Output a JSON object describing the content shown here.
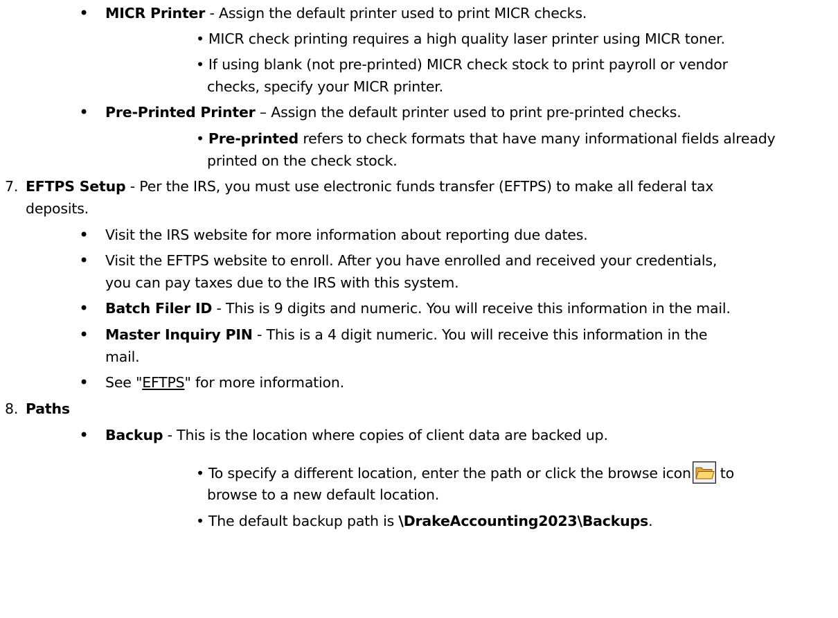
{
  "micr": {
    "term": "MICR Printer",
    "desc": " - Assign the default printer used to print MICR checks.",
    "sub1": "MICR check printing requires a high quality laser printer using MICR toner.",
    "sub2_l1": "If using blank (not pre-printed) MICR check stock to print payroll or vendor",
    "sub2_l2": "checks, specify your MICR printer."
  },
  "preprinted": {
    "term": "Pre-Printed Printer",
    "desc": " – Assign the default printer used to print pre-printed checks.",
    "sub_term": "Pre-printed",
    "sub_l1": " refers to check formats that have many informational fields already",
    "sub_l2": "printed on the check stock."
  },
  "eftps": {
    "num": "7.",
    "term": "EFTPS Setup",
    "desc_l1": " - Per the IRS, you must use electronic funds transfer (EFTPS) to make all federal tax",
    "desc_l2": "deposits.",
    "b1": "Visit the IRS website for more information about reporting due dates.",
    "b2_l1": "Visit the EFTPS website to enroll. After you have enrolled and received your credentials,",
    "b2_l2": "you can pay taxes due to the IRS with this system.",
    "b3_term": "Batch Filer ID",
    "b3_desc": " - This is 9 digits and numeric. You will receive this information in the mail.",
    "b4_term": "Master Inquiry PIN",
    "b4_desc_l1": " - This is a 4 digit numeric. You will receive this information in the",
    "b4_desc_l2": "mail.",
    "b5_pre": "See \"",
    "b5_link": "EFTPS",
    "b5_post": "\" for more information."
  },
  "paths": {
    "num": "8.",
    "term": "Paths",
    "backup_term": "Backup",
    "backup_desc": " - This is the location where copies of client data are backed up.",
    "sub1_pre": "To specify a different location, enter the path or click the browse icon",
    "sub1_post": "to",
    "sub1_l2": "browse to a new default location.",
    "sub2_pre": "The default backup path is ",
    "sub2_path": "\\DrakeAccounting2023\\Backups",
    "sub2_post": "."
  },
  "bullets": {
    "big": "•",
    "small": "•"
  },
  "icons": {
    "folder": "folder-browse-icon"
  }
}
